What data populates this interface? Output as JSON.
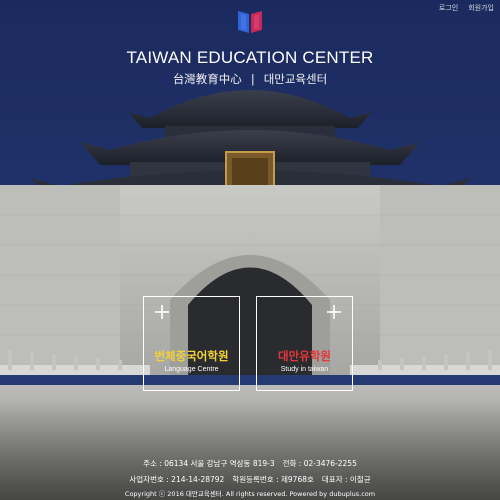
{
  "nav": {
    "login": "로그인",
    "join": "회원가입"
  },
  "brand": {
    "title_en": "TAIWAN EDUCATION CENTER",
    "subtitle_zh": "台灣教育中心",
    "subtitle_sep": "|",
    "subtitle_ko": "대만교육센터"
  },
  "cards": [
    {
      "title": "번체중국어학원",
      "subtitle": "Language Centre",
      "title_color": "#f3d23a"
    },
    {
      "title": "대만유학원",
      "subtitle": "Study in taiwan",
      "title_color": "#e6363a"
    }
  ],
  "footer": {
    "address": "주소 : 06134 서울 강남구 역삼동 819-3",
    "phone": "전화 : 02-3476-2255",
    "business_no": "사업자번호 : 214-14-28792",
    "academy_no": "학원등록번호 : 제9768호",
    "ceo": "대표자 : 이철균",
    "copyright": "Copyright ⓒ 2016 대만교육센터. All rights reserved. Powered by dubuplus.com"
  },
  "colors": {
    "sky": "#1e2f66",
    "logo_left": "#2f63d6",
    "logo_right": "#c6285a"
  }
}
